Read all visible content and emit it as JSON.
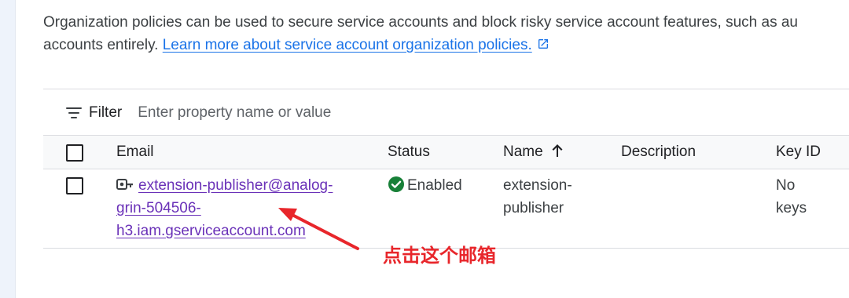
{
  "intro": {
    "line1": "Organization policies can be used to secure service accounts and block risky service account features, such as au",
    "line2_prefix": "accounts entirely.",
    "link": "Learn more about service account organization policies."
  },
  "filter": {
    "label": "Filter",
    "placeholder": "Enter property name or value"
  },
  "table": {
    "headers": {
      "email": "Email",
      "status": "Status",
      "name": "Name",
      "description": "Description",
      "key_id": "Key ID"
    },
    "rows": [
      {
        "email_lines": [
          "extension-publisher@analog-",
          "grin-504506-",
          "h3.iam.gserviceaccount.com"
        ],
        "status": "Enabled",
        "name_lines": [
          "extension-",
          "publisher"
        ],
        "description": "",
        "key_lines": [
          "No",
          "keys"
        ]
      }
    ]
  },
  "annotation": {
    "text": "点击这个邮箱",
    "color": "#e8262b"
  },
  "colors": {
    "link": "#1a73e8",
    "email_link": "#6a31b8",
    "status_ok": "#188038"
  },
  "icons": {
    "filter": "filter-list-icon",
    "external_link": "open-in-new-icon",
    "sort": "arrow-upward-icon",
    "service_account": "service-account-key-icon",
    "status": "check-circle-icon"
  }
}
